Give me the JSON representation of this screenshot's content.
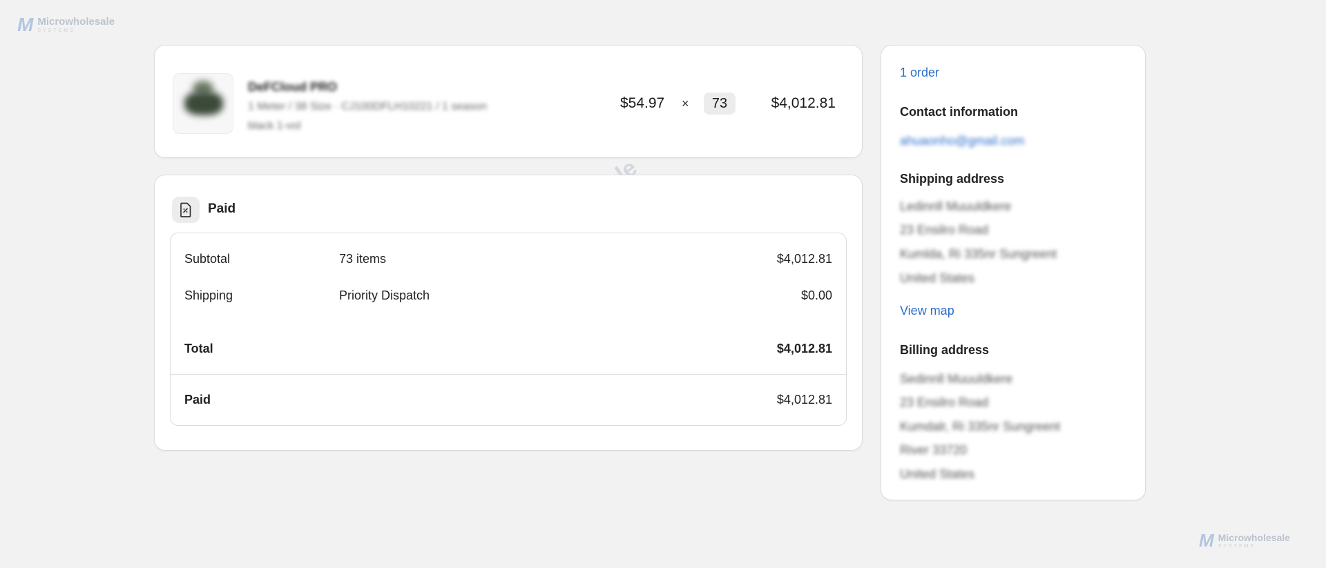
{
  "brand": {
    "name": "Microwholesale",
    "tagline": "SYSTEMS",
    "mark": "M"
  },
  "product": {
    "title": "DeFCloud PRO",
    "meta": "1 Meter / 38 Size · CJ100DFLH10221 / 1 season",
    "extra": "black 1-vol",
    "unit_price": "$54.97",
    "times_symbol": "×",
    "quantity": "73",
    "line_total": "$4,012.81"
  },
  "payment": {
    "status": "Paid",
    "icon": "receipt-icon",
    "subtotal_label": "Subtotal",
    "subtotal_items": "73 items",
    "subtotal_value": "$4,012.81",
    "shipping_label": "Shipping",
    "shipping_method": "Priority Dispatch",
    "shipping_value": "$0.00",
    "total_label": "Total",
    "total_value": "$4,012.81",
    "paid_label": "Paid",
    "paid_value": "$4,012.81"
  },
  "customer": {
    "orders_link": "1 order",
    "contact_heading": "Contact information",
    "email": "ahuaonho@gmail.com",
    "shipping_heading": "Shipping address",
    "shipping_lines": [
      "Ledinnll Muuuldkere",
      "23 Ensilro Road",
      "Kumlda, Ri 335nr Sungreent",
      "United States"
    ],
    "view_map": "View map",
    "billing_heading": "Billing address",
    "billing_lines": [
      "Sedinnll Muuuldkere",
      "23 Ensilro Road",
      "Kumdalr, Ri 335nr Sungreent",
      "River 33720",
      "United States"
    ]
  },
  "colors": {
    "link": "#2c6ecb",
    "background": "#f2f2f2",
    "card": "#ffffff"
  }
}
